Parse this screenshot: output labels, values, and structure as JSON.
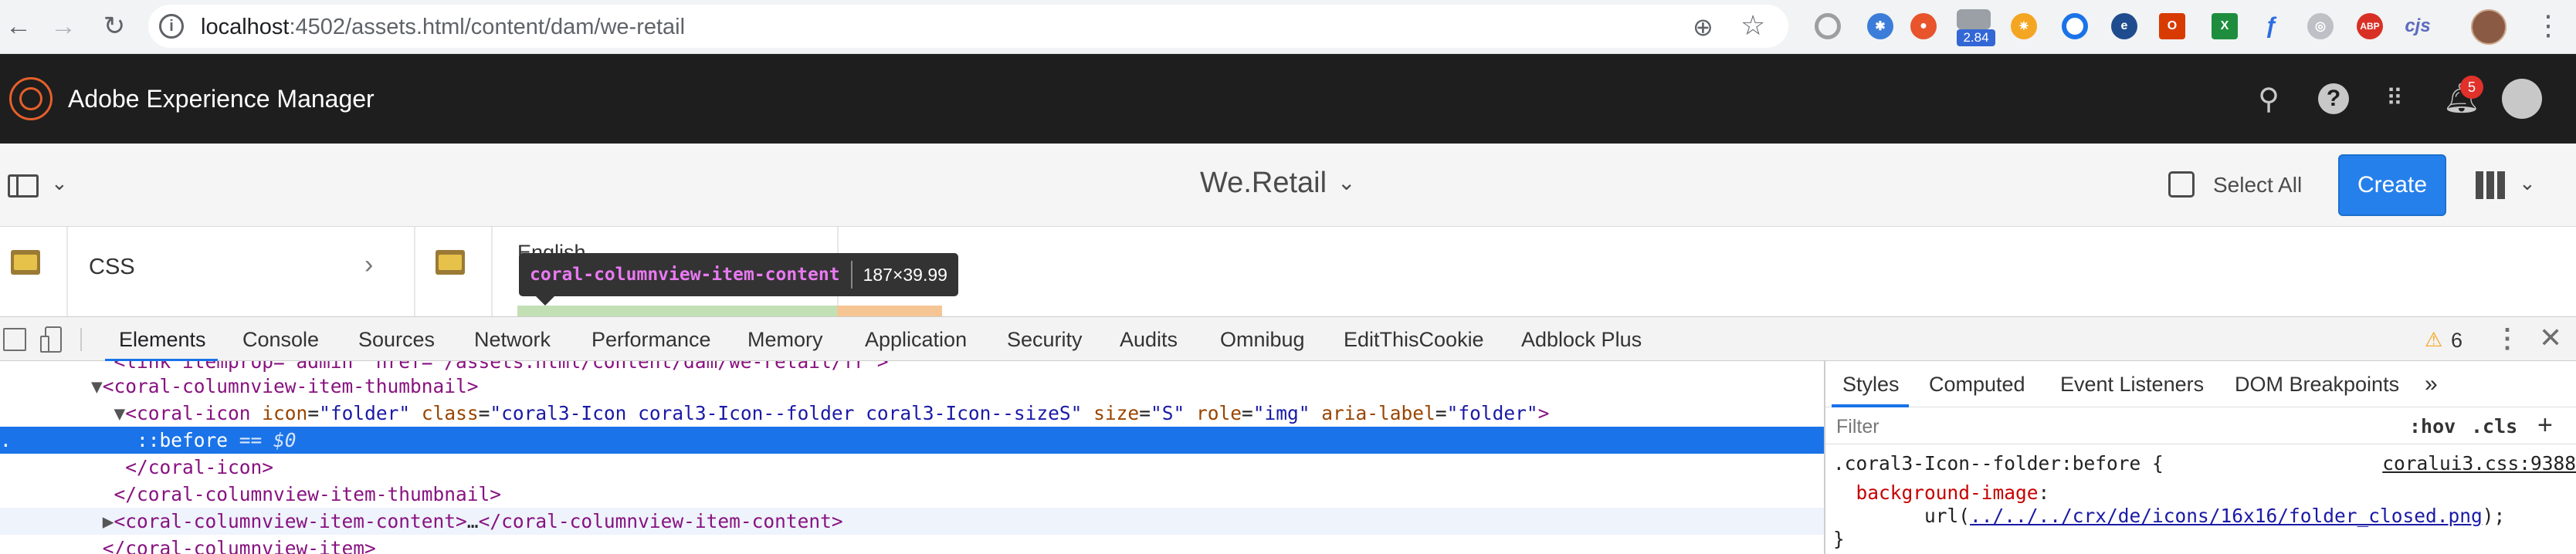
{
  "browser": {
    "url_host": "localhost",
    "url_path": ":4502/assets.html/content/dam/we-retail",
    "extension_badge": "2.84"
  },
  "aem": {
    "product_title": "Adobe Experience Manager",
    "notification_count": "5",
    "folder_title": "We.Retail",
    "select_all_label": "Select All",
    "create_label": "Create"
  },
  "columns": {
    "item_css": "CSS",
    "item_english": "English"
  },
  "inspector_tooltip": {
    "tag": "coral-columnview-item-content",
    "dimensions": "187×39.99"
  },
  "devtools": {
    "tabs": [
      "Elements",
      "Console",
      "Sources",
      "Network",
      "Performance",
      "Memory",
      "Application",
      "Security",
      "Audits",
      "Omnibug",
      "EditThisCookie",
      "Adblock Plus"
    ],
    "warning_count": "6",
    "dom": {
      "line0": "<link itemprop=\"admin\" href=\"/assets.html/content/dam/we-retail/fr\">",
      "l1_tag": "<coral-columnview-item-thumbnail>",
      "l2_open": "<coral-icon ",
      "l2_a1": "icon",
      "l2_v1": "\"folder\"",
      "l2_a2": "class",
      "l2_v2": "\"coral3-Icon coral3-Icon--folder coral3-Icon--sizeS\"",
      "l2_a3": "size",
      "l2_v3": "\"S\"",
      "l2_a4": "role",
      "l2_v4": "\"img\"",
      "l2_a5": "aria-label",
      "l2_v5": "\"folder\"",
      "l2_close": ">",
      "l3_pseudo": "::before",
      "l3_eq": " == $0",
      "l4_tag": "</coral-icon>",
      "l5_tag": "</coral-columnview-item-thumbnail>",
      "l6_open": "<coral-columnview-item-content>",
      "l6_ellipsis": "…",
      "l6_close": "</coral-columnview-item-content>",
      "l7_tag": "</coral-columnview-item>"
    },
    "styles": {
      "tabs": [
        "Styles",
        "Computed",
        "Event Listeners",
        "DOM Breakpoints"
      ],
      "filter_placeholder": "Filter",
      "hov_label": ":hov",
      "cls_label": ".cls",
      "selector": ".coral3-Icon--folder:before {",
      "source": "coralui3.css:9388",
      "property": "background-image",
      "url_prefix": "url(",
      "url_value": "../../../crx/de/icons/16x16/folder_closed.png",
      "url_suffix": ");",
      "closing_brace": "}"
    }
  }
}
